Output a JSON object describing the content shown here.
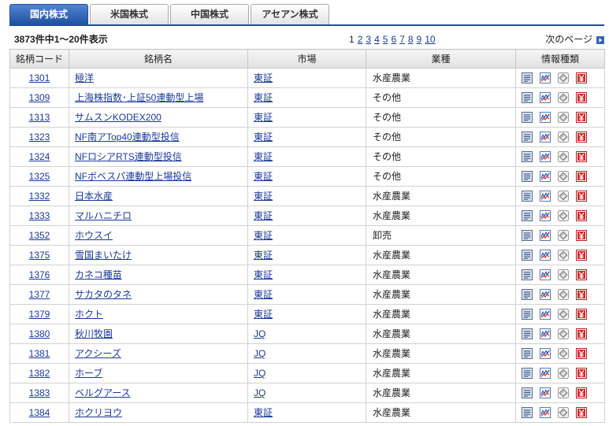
{
  "tabs": [
    {
      "label": "国内株式",
      "active": true
    },
    {
      "label": "米国株式",
      "active": false
    },
    {
      "label": "中国株式",
      "active": false
    },
    {
      "label": "アセアン株式",
      "active": false
    }
  ],
  "summary": "3873件中1～20件表示",
  "pagination": {
    "pages": [
      "1",
      "2",
      "3",
      "4",
      "5",
      "6",
      "7",
      "8",
      "9",
      "10"
    ],
    "current": "1",
    "next_label": "次のページ",
    "next_icon": "next-arrow-icon"
  },
  "table": {
    "headers": {
      "code": "銘柄コード",
      "name": "銘柄名",
      "market": "市場",
      "industry": "業種",
      "info": "情報種類"
    },
    "info_icons": [
      "document-icon",
      "chart-icon",
      "badge-icon",
      "yen-icon"
    ],
    "rows": [
      {
        "code": "1301",
        "name": "極洋",
        "market": "東証",
        "industry": "水産農業"
      },
      {
        "code": "1309",
        "name": "上海株指数･上証50連動型上場",
        "market": "東証",
        "industry": "その他"
      },
      {
        "code": "1313",
        "name": "サムスンKODEX200",
        "market": "東証",
        "industry": "その他"
      },
      {
        "code": "1323",
        "name": "NF南アTop40連動型投信",
        "market": "東証",
        "industry": "その他"
      },
      {
        "code": "1324",
        "name": "NFロシアRTS連動型投信",
        "market": "東証",
        "industry": "その他"
      },
      {
        "code": "1325",
        "name": "NFボベスパ連動型上場投信",
        "market": "東証",
        "industry": "その他"
      },
      {
        "code": "1332",
        "name": "日本水産",
        "market": "東証",
        "industry": "水産農業"
      },
      {
        "code": "1333",
        "name": "マルハニチロ",
        "market": "東証",
        "industry": "水産農業"
      },
      {
        "code": "1352",
        "name": "ホウスイ",
        "market": "東証",
        "industry": "卸売"
      },
      {
        "code": "1375",
        "name": "雪国まいたけ",
        "market": "東証",
        "industry": "水産農業"
      },
      {
        "code": "1376",
        "name": "カネコ種苗",
        "market": "東証",
        "industry": "水産農業"
      },
      {
        "code": "1377",
        "name": "サカタのタネ",
        "market": "東証",
        "industry": "水産農業"
      },
      {
        "code": "1379",
        "name": "ホクト",
        "market": "東証",
        "industry": "水産農業"
      },
      {
        "code": "1380",
        "name": "秋川牧園",
        "market": "JQ",
        "industry": "水産農業"
      },
      {
        "code": "1381",
        "name": "アクシーズ",
        "market": "JQ",
        "industry": "水産農業"
      },
      {
        "code": "1382",
        "name": "ホーブ",
        "market": "JQ",
        "industry": "水産農業"
      },
      {
        "code": "1383",
        "name": "ベルグアース",
        "market": "JQ",
        "industry": "水産農業"
      },
      {
        "code": "1384",
        "name": "ホクリヨウ",
        "market": "東証",
        "industry": "水産農業"
      }
    ]
  },
  "colors": {
    "active_tab": "#1f4f9f",
    "link": "#1a3a9a",
    "header_bg": "#e9e9e9",
    "border": "#d2d2d2",
    "yen_icon": "#d9262a"
  }
}
